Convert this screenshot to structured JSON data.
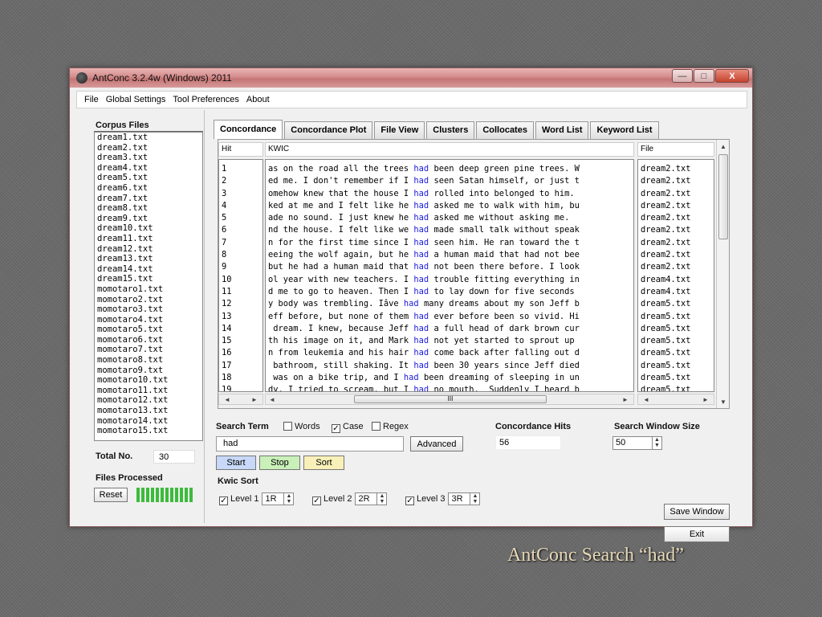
{
  "window": {
    "title": "AntConc 3.2.4w (Windows) 2011",
    "minimize": "—",
    "maximize": "□",
    "close": "X"
  },
  "menu": [
    "File",
    "Global Settings",
    "Tool Preferences",
    "About"
  ],
  "sidebar": {
    "corpus_label": "Corpus Files",
    "files": [
      "dream1.txt",
      "dream2.txt",
      "dream3.txt",
      "dream4.txt",
      "dream5.txt",
      "dream6.txt",
      "dream7.txt",
      "dream8.txt",
      "dream9.txt",
      "dream10.txt",
      "dream11.txt",
      "dream12.txt",
      "dream13.txt",
      "dream14.txt",
      "dream15.txt",
      "momotaro1.txt",
      "momotaro2.txt",
      "momotaro3.txt",
      "momotaro4.txt",
      "momotaro5.txt",
      "momotaro6.txt",
      "momotaro7.txt",
      "momotaro8.txt",
      "momotaro9.txt",
      "momotaro10.txt",
      "momotaro11.txt",
      "momotaro12.txt",
      "momotaro13.txt",
      "momotaro14.txt",
      "momotaro15.txt"
    ],
    "total_label": "Total No.",
    "total_value": "30",
    "processed_label": "Files Processed",
    "reset_label": "Reset",
    "progress_fraction": 1.0
  },
  "tabs": [
    "Concordance",
    "Concordance Plot",
    "File View",
    "Clusters",
    "Collocates",
    "Word List",
    "Keyword List"
  ],
  "results": {
    "col_hit": "Hit",
    "col_kwic": "KWIC",
    "col_file": "File",
    "scroll_mid": "III",
    "rows": [
      {
        "hit": "1",
        "left": "as on the road all the trees ",
        "kw": "had",
        "right": " been deep green pine trees. W",
        "file": "dream2.txt"
      },
      {
        "hit": "2",
        "left": "ed me. I don't remember if I ",
        "kw": "had",
        "right": " seen Satan himself, or just t",
        "file": "dream2.txt"
      },
      {
        "hit": "3",
        "left": "omehow knew that the house I ",
        "kw": "had",
        "right": " rolled into belonged to him.",
        "file": "dream2.txt"
      },
      {
        "hit": "4",
        "left": "ked at me and I felt like he ",
        "kw": "had",
        "right": " asked me to walk with him, bu",
        "file": "dream2.txt"
      },
      {
        "hit": "5",
        "left": "ade no sound. I just knew he ",
        "kw": "had",
        "right": " asked me without asking me.",
        "file": "dream2.txt"
      },
      {
        "hit": "6",
        "left": "nd the house. I felt like we ",
        "kw": "had",
        "right": " made small talk without speak",
        "file": "dream2.txt"
      },
      {
        "hit": "7",
        "left": "n for the first time since I ",
        "kw": "had",
        "right": " seen him. He ran toward the t",
        "file": "dream2.txt"
      },
      {
        "hit": "8",
        "left": "eeing the wolf again, but he ",
        "kw": "had",
        "right": " a human maid that had not bee",
        "file": "dream2.txt"
      },
      {
        "hit": "9",
        "left": "but he had a human maid that ",
        "kw": "had",
        "right": " not been there before. I look",
        "file": "dream2.txt"
      },
      {
        "hit": "10",
        "left": "ol year with new teachers. I ",
        "kw": "had",
        "right": " trouble fitting everything in",
        "file": "dream4.txt"
      },
      {
        "hit": "11",
        "left": "d me to go to heaven. Then I ",
        "kw": "had",
        "right": " to lay down for five seconds",
        "file": "dream4.txt"
      },
      {
        "hit": "12",
        "left": "y body was trembling. Iâve ",
        "kw": "had",
        "right": " many dreams about my son Jeff b",
        "file": "dream5.txt"
      },
      {
        "hit": "13",
        "left": "eff before, but none of them ",
        "kw": "had",
        "right": " ever before been so vivid. Hi",
        "file": "dream5.txt"
      },
      {
        "hit": "14",
        "left": " dream. I knew, because Jeff ",
        "kw": "had",
        "right": " a full head of dark brown cur",
        "file": "dream5.txt"
      },
      {
        "hit": "15",
        "left": "th his image on it, and Mark ",
        "kw": "had",
        "right": " not yet started to sprout up",
        "file": "dream5.txt"
      },
      {
        "hit": "16",
        "left": "n from leukemia and his hair ",
        "kw": "had",
        "right": " come back after falling out d",
        "file": "dream5.txt"
      },
      {
        "hit": "17",
        "left": " bathroom, still shaking. It ",
        "kw": "had",
        "right": " been 30 years since Jeff died",
        "file": "dream5.txt"
      },
      {
        "hit": "18",
        "left": " was on a bike trip, and I ",
        "kw": "had",
        "right": " been dreaming of sleeping in un",
        "file": "dream5.txt"
      },
      {
        "hit": "19",
        "left": "dy. I tried to scream, but I ",
        "kw": "had",
        "right": " no mouth.  Suddenly I heard b",
        "file": "dream5.txt"
      }
    ]
  },
  "search": {
    "term_label": "Search Term",
    "words_label": "Words",
    "case_label": "Case",
    "regex_label": "Regex",
    "words_checked": false,
    "case_checked": true,
    "regex_checked": false,
    "term_value": "had",
    "advanced_label": "Advanced",
    "start_label": "Start",
    "stop_label": "Stop",
    "sort_label": "Sort",
    "hits_label": "Concordance Hits",
    "hits_value": "56",
    "window_size_label": "Search Window Size",
    "window_size_value": "50",
    "save_window_label": "Save Window",
    "exit_label": "Exit",
    "kwic_sort_label": "Kwic Sort",
    "levels": [
      {
        "label": "Level 1",
        "value": "1R"
      },
      {
        "label": "Level 2",
        "value": "2R"
      },
      {
        "label": "Level 3",
        "value": "3R"
      }
    ]
  },
  "caption": "AntConc Search “had”",
  "colors": {
    "keyword": "#1a1adc",
    "start_btn": "#c8d8f8",
    "stop_btn": "#c8f0b8",
    "sort_btn": "#f8f0b8"
  }
}
